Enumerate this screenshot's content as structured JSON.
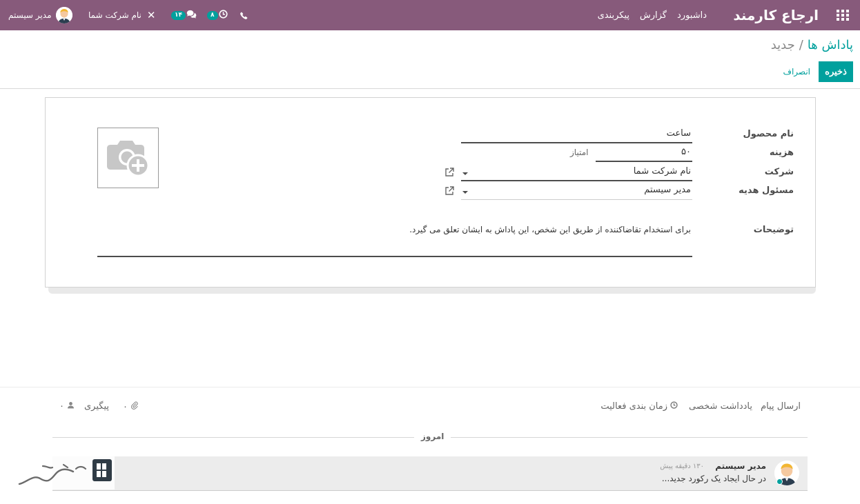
{
  "navbar": {
    "app_title": "ارجاع کارمند",
    "menu": [
      "داشبورد",
      "گزارش",
      "پیکربندی"
    ],
    "user_name": "مدیر سیستم",
    "company_name": "نام شرکت شما",
    "messages_count": "۱۴",
    "activities_count": "۸",
    "bg_color": "#875a7b",
    "accent_color": "#00a09d"
  },
  "breadcrumb": {
    "parent": "پاداش ها",
    "separator": "/",
    "current": "جدید"
  },
  "actions": {
    "save": "ذخیره",
    "discard": "انصراف"
  },
  "form": {
    "labels": {
      "product_name": "نام محصول",
      "cost": "هزینه",
      "company": "شرکت",
      "gift_manager": "مسئول هدیه",
      "description": "توضیحات"
    },
    "values": {
      "product_name": "ساعت",
      "cost": "۵۰",
      "cost_unit": "امتیاز",
      "company": "نام شرکت شما",
      "gift_manager": "مدیر سیستم",
      "description": "برای استخدام تقاضاکننده از طریق این شخص، این پاداش به ایشان تعلق می گیرد."
    },
    "image_icon": "camera-add-icon"
  },
  "chatter": {
    "send_message": "ارسال پیام",
    "log_note": "یادداشت شخصی",
    "schedule_activity": "زمان بندی فعالیت",
    "follow": "پیگیری",
    "attachments_count": "۰",
    "followers_count": "۰",
    "today": "امروز",
    "message": {
      "author": "مدیر سیستم",
      "time": "۱۳۰ دقیقه پیش",
      "body": "در حال ایجاد یک رکورد جدید..."
    }
  }
}
